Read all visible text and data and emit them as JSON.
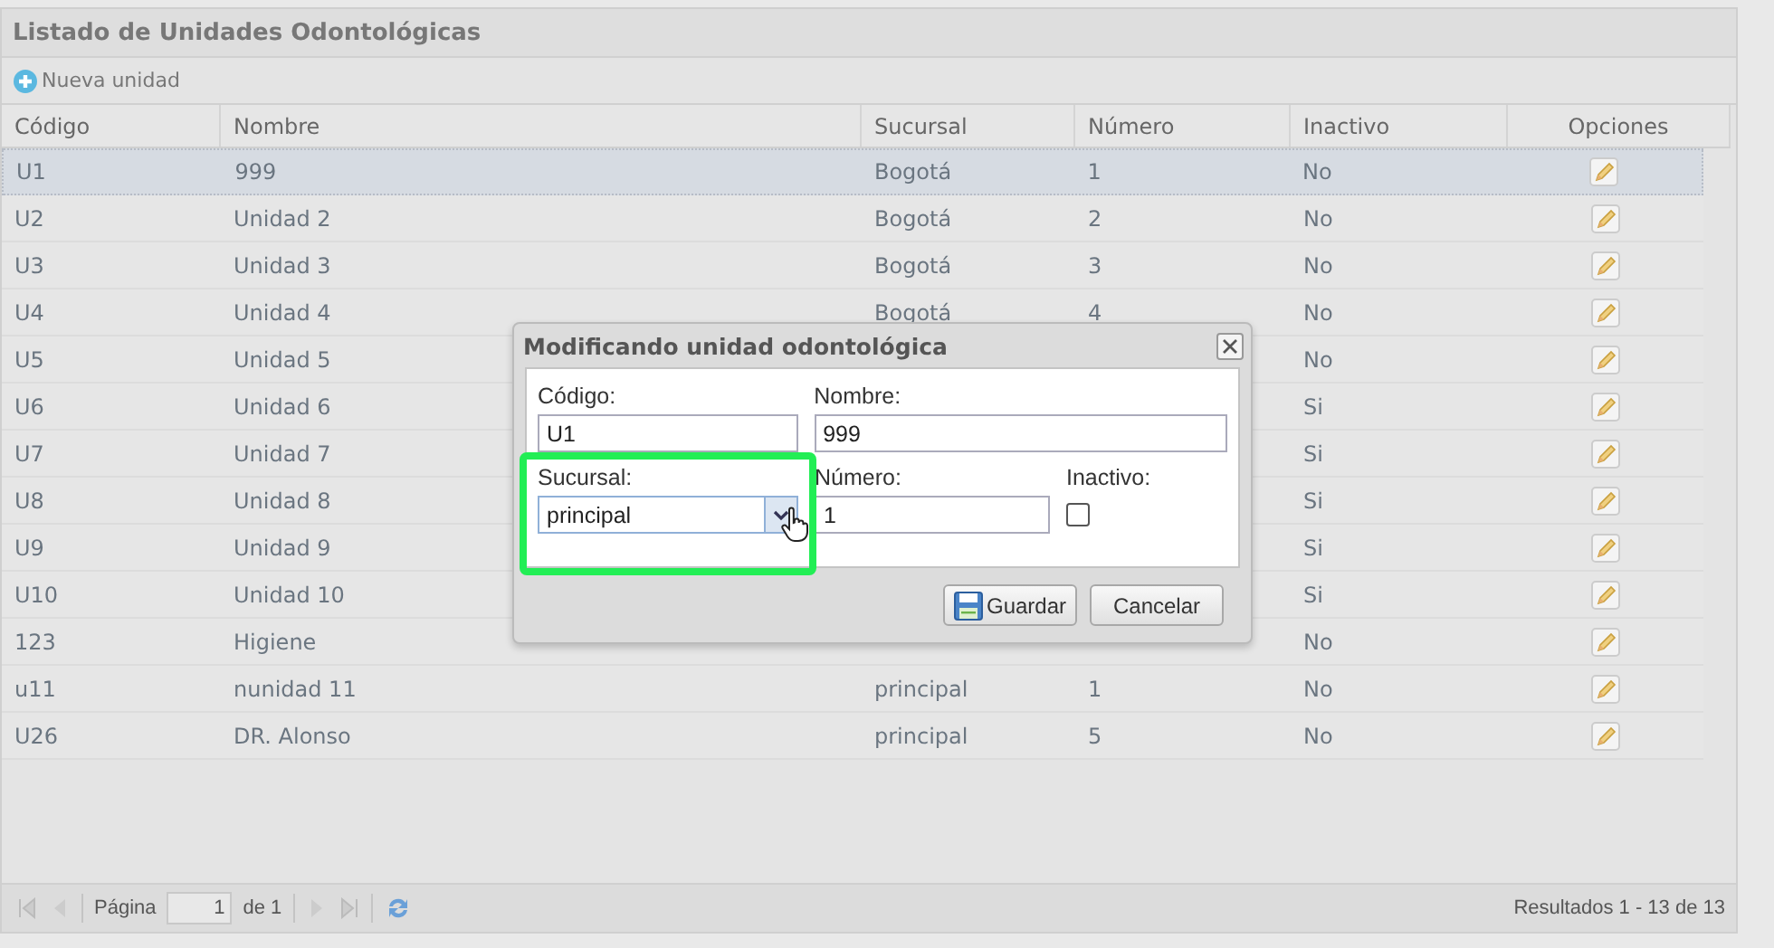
{
  "panel": {
    "title": "Listado de Unidades Odontológicas"
  },
  "toolbar": {
    "new_button": "Nueva unidad"
  },
  "table": {
    "columns": [
      "Código",
      "Nombre",
      "Sucursal",
      "Número",
      "Inactivo",
      "Opciones"
    ],
    "rows": [
      {
        "code": "U1",
        "name": "999",
        "branch": "Bogotá",
        "number": "1",
        "inactive": "No",
        "selected": true
      },
      {
        "code": "U2",
        "name": "Unidad 2",
        "branch": "Bogotá",
        "number": "2",
        "inactive": "No",
        "selected": false
      },
      {
        "code": "U3",
        "name": "Unidad 3",
        "branch": "Bogotá",
        "number": "3",
        "inactive": "No",
        "selected": false
      },
      {
        "code": "U4",
        "name": "Unidad 4",
        "branch": "Bogotá",
        "number": "4",
        "inactive": "No",
        "selected": false
      },
      {
        "code": "U5",
        "name": "Unidad 5",
        "inactive": "No",
        "selected": false
      },
      {
        "code": "U6",
        "name": "Unidad 6",
        "inactive": "Si",
        "selected": false
      },
      {
        "code": "U7",
        "name": "Unidad 7",
        "inactive": "Si",
        "selected": false
      },
      {
        "code": "U8",
        "name": "Unidad 8",
        "inactive": "Si",
        "selected": false
      },
      {
        "code": "U9",
        "name": "Unidad 9",
        "inactive": "Si",
        "selected": false
      },
      {
        "code": "U10",
        "name": "Unidad 10",
        "inactive": "Si",
        "selected": false
      },
      {
        "code": "123",
        "name": "Higiene",
        "inactive": "No",
        "selected": false
      },
      {
        "code": "u11",
        "name": "nunidad 11",
        "branch": "principal",
        "number": "1",
        "inactive": "No",
        "selected": false
      },
      {
        "code": "U26",
        "name": "DR. Alonso",
        "branch": "principal",
        "number": "5",
        "inactive": "No",
        "selected": false
      }
    ]
  },
  "pager": {
    "page_label": "Página",
    "page": "1",
    "of": "de 1",
    "results": "Resultados 1 - 13 de 13"
  },
  "dialog": {
    "title": "Modificando unidad odontológica",
    "code": {
      "label": "Código:",
      "value": "U1"
    },
    "name": {
      "label": "Nombre:",
      "value": "999"
    },
    "branch": {
      "label": "Sucursal:",
      "value": "principal"
    },
    "number": {
      "label": "Número:",
      "value": "1"
    },
    "inactive": {
      "label": "Inactivo:",
      "checked": false
    },
    "buttons": [
      {
        "kind": "save",
        "label": "Guardar"
      },
      {
        "kind": "cancel",
        "label": "Cancelar"
      }
    ]
  }
}
